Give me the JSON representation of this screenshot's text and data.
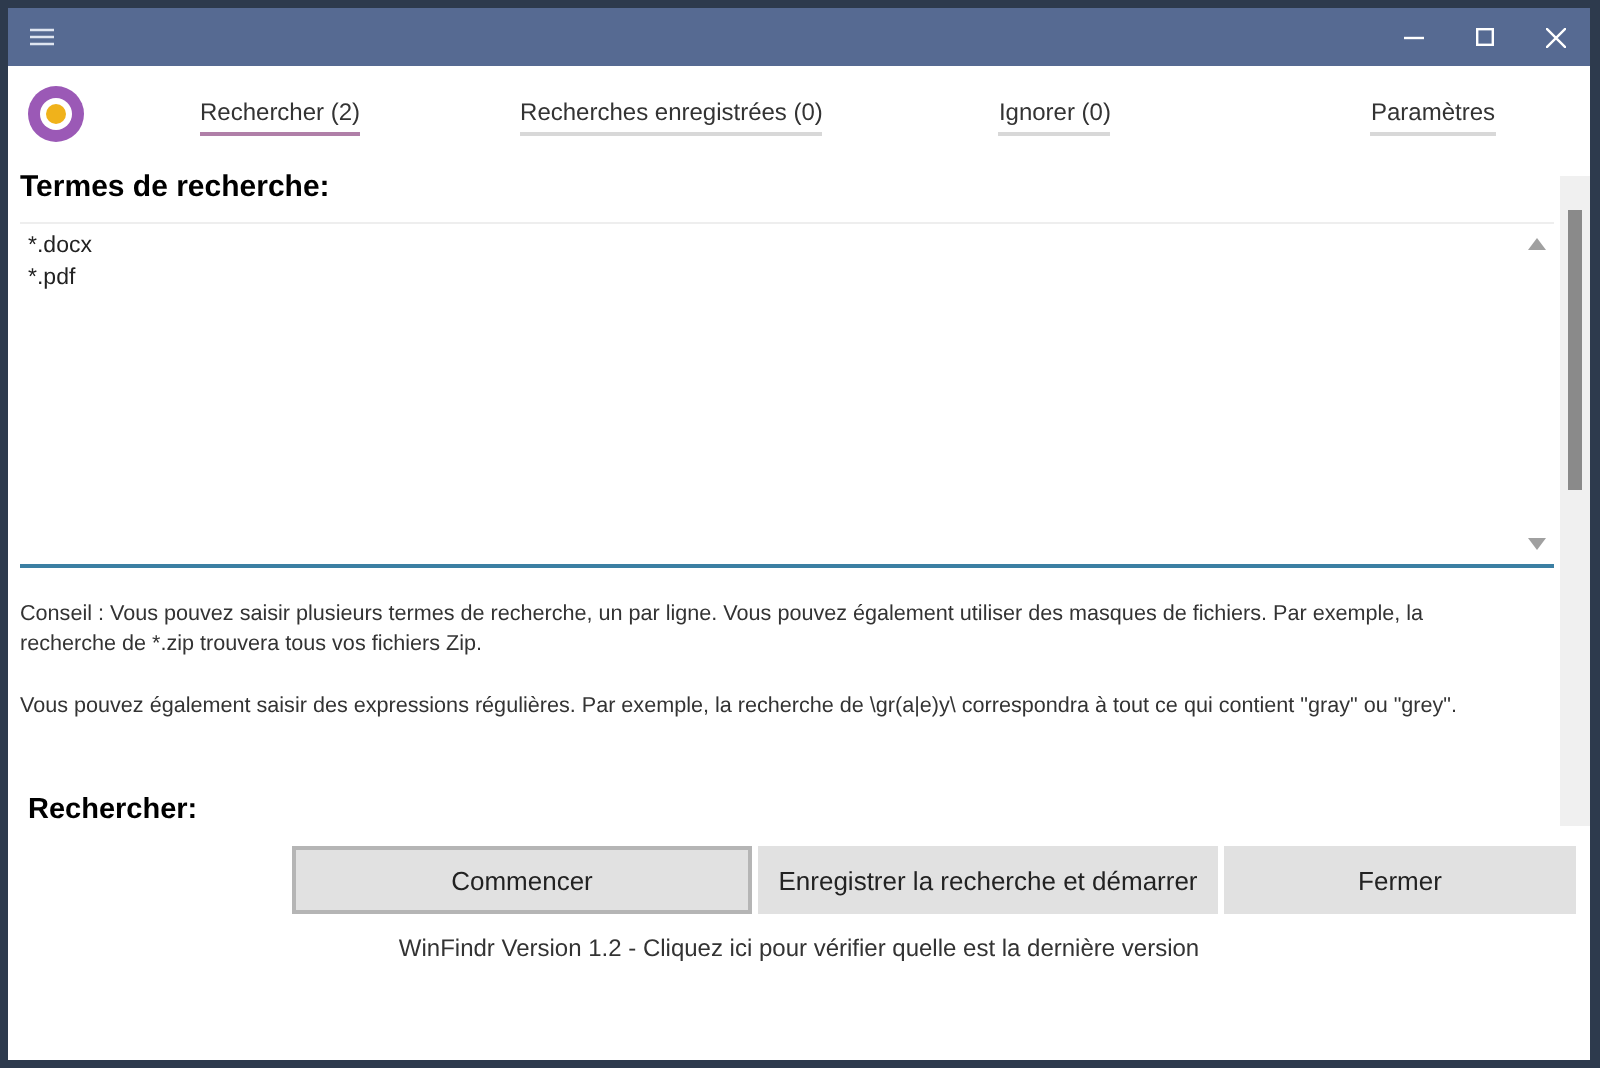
{
  "tabs": [
    {
      "label": "Rechercher (2)",
      "selected": true
    },
    {
      "label": "Recherches enregistrées (0)",
      "selected": false
    },
    {
      "label": "Ignorer (0)",
      "selected": false
    },
    {
      "label": "Paramètres",
      "selected": false
    }
  ],
  "terms": {
    "heading": "Termes de recherche:",
    "value": "*.docx\n*.pdf"
  },
  "hints": [
    "Conseil : Vous pouvez saisir plusieurs termes de recherche, un par ligne. Vous pouvez également utiliser des masques de fichiers. Par exemple, la recherche de *.zip trouvera tous vos fichiers Zip.",
    "Vous pouvez également saisir des expressions régulières. Par exemple, la recherche de \\gr(a|e)y\\ correspondra à tout ce qui contient \"gray\" ou \"grey\"."
  ],
  "search_heading": "Rechercher:",
  "buttons": [
    {
      "label": "Commencer",
      "focused": true
    },
    {
      "label": "Enregistrer la recherche et démarrer",
      "focused": false
    },
    {
      "label": "Fermer",
      "focused": false
    }
  ],
  "footer": "WinFindr Version 1.2 - Cliquez ici pour vérifier quelle est la dernière version"
}
